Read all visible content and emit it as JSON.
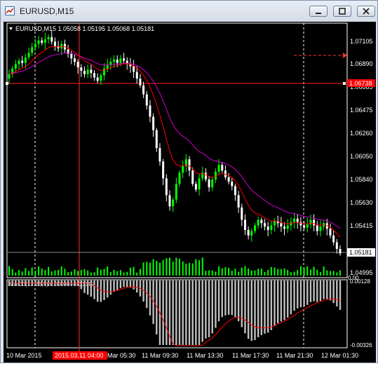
{
  "window": {
    "title": "EURUSD,M15",
    "buttons": [
      "minimize",
      "maximize",
      "close"
    ]
  },
  "chart": {
    "header": "EURUSD,M15  1.05058 1.05195 1.05068 1.05181",
    "price_ticks": [
      "1.07105",
      "1.06890",
      "1.06685",
      "1.06475",
      "1.06260",
      "1.06050",
      "1.05840",
      "1.05630",
      "1.05415",
      "1.04995"
    ],
    "hline_label": "1.06738",
    "current_price_label": "1.05181",
    "indicator_header": "MACD(12,26,9) 0.00098 -0.00045",
    "indicator_ticks": [
      "0.00128",
      "0.00",
      "-0.00326"
    ],
    "time_labels": [
      "10 Mar 2015",
      "Mar 05:30",
      "11 Mar 09:30",
      "11 Mar 13:30",
      "11 Mar 17:30",
      "11 Mar 21:30",
      "12 Mar 01:30"
    ],
    "crosshair_time": "2015.03.11 04:00",
    "colors": {
      "bull": "#00ff00",
      "bear": "#ffffff",
      "ma_fast": "#ff0000",
      "ma_slow": "#cc00cc",
      "grid": "#ffffff",
      "hline": "#ff0000",
      "histogram": "#c0c0c0",
      "signal": "#ff0000"
    }
  },
  "chart_data": {
    "type": "candlestick",
    "symbol": "EURUSD",
    "timeframe": "M15",
    "ylim": [
      1.04995,
      1.0721
    ],
    "close": [
      1.0678,
      1.0683,
      1.0687,
      1.069,
      1.0688,
      1.0693,
      1.0697,
      1.0702,
      1.0705,
      1.0708,
      1.0706,
      1.0709,
      1.0711,
      1.0707,
      1.0703,
      1.0701,
      1.0705,
      1.07,
      1.0696,
      1.0692,
      1.0689,
      1.0684,
      1.0681,
      1.0678,
      1.0682,
      1.0679,
      1.0675,
      1.0672,
      1.0677,
      1.0683,
      1.0686,
      1.0689,
      1.0691,
      1.0688,
      1.0692,
      1.069,
      1.0687,
      1.0685,
      1.068,
      1.0674,
      1.0668,
      1.066,
      1.065,
      1.064,
      1.0628,
      1.0612,
      1.06,
      1.0585,
      1.057,
      1.056,
      1.0566,
      1.058,
      1.059,
      1.0596,
      1.0602,
      1.0592,
      1.058,
      1.0575,
      1.0585,
      1.059,
      1.0584,
      1.0577,
      1.0584,
      1.0591,
      1.0597,
      1.0592,
      1.0586,
      1.0582,
      1.0578,
      1.057,
      1.0559,
      1.0548,
      1.0539,
      1.0534,
      1.0538,
      1.0543,
      1.0548,
      1.0545,
      1.0542,
      1.0539,
      1.0543,
      1.0547,
      1.0545,
      1.0542,
      1.054,
      1.0543,
      1.0546,
      1.0549,
      1.0546,
      1.0543,
      1.0541,
      1.0544,
      1.0548,
      1.0543,
      1.0538,
      1.0542,
      1.0545,
      1.054,
      1.0534,
      1.0528,
      1.0522,
      1.0518
    ],
    "ma_fast_last": 1.0536,
    "ma_slow_last": 1.0541,
    "horizontal_line": 1.06738,
    "last_price": 1.05181
  }
}
